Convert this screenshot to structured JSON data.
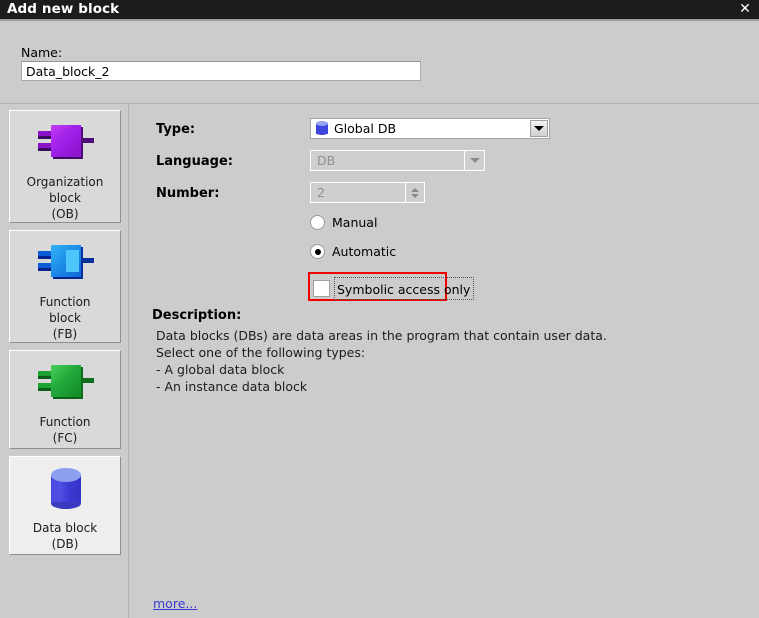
{
  "window": {
    "title": "Add new block",
    "close_label": "✕"
  },
  "name_field": {
    "label": "Name:",
    "value": "Data_block_2",
    "placeholder": ""
  },
  "sidebar": {
    "items": [
      {
        "id": "organization-block",
        "label": "Organization\nblock\n(OB)",
        "icon": "organization-block-icon",
        "color": "#a020e8",
        "selected": false
      },
      {
        "id": "function-block",
        "label": "Function\nblock\n(FB)",
        "icon": "function-block-icon",
        "color": "#1e90e8",
        "selected": false
      },
      {
        "id": "function",
        "label": "Function\n(FC)",
        "icon": "function-icon",
        "color": "#22a83a",
        "selected": false
      },
      {
        "id": "data-block",
        "label": "Data block\n(DB)",
        "icon": "data-block-icon",
        "color": "#3f46dd",
        "selected": true
      }
    ]
  },
  "form": {
    "type": {
      "label": "Type:",
      "value": "Global DB",
      "icon": "database-cylinder-icon",
      "enabled": true
    },
    "language": {
      "label": "Language:",
      "value": "DB",
      "enabled": false
    },
    "number": {
      "label": "Number:",
      "value": "2",
      "enabled": false
    },
    "numbering_mode": {
      "manual": {
        "label": "Manual",
        "checked": false
      },
      "automatic": {
        "label": "Automatic",
        "checked": true
      }
    },
    "symbolic_access": {
      "label": "Symbolic access only",
      "checked": false,
      "highlight_color": "#f20000"
    }
  },
  "description": {
    "label": "Description:",
    "lines": [
      "Data blocks (DBs) are data areas in the program that contain user data.",
      "Select one of the following types:",
      "- A global data block",
      "- An instance data block"
    ]
  },
  "more_link": {
    "label": "more..."
  }
}
